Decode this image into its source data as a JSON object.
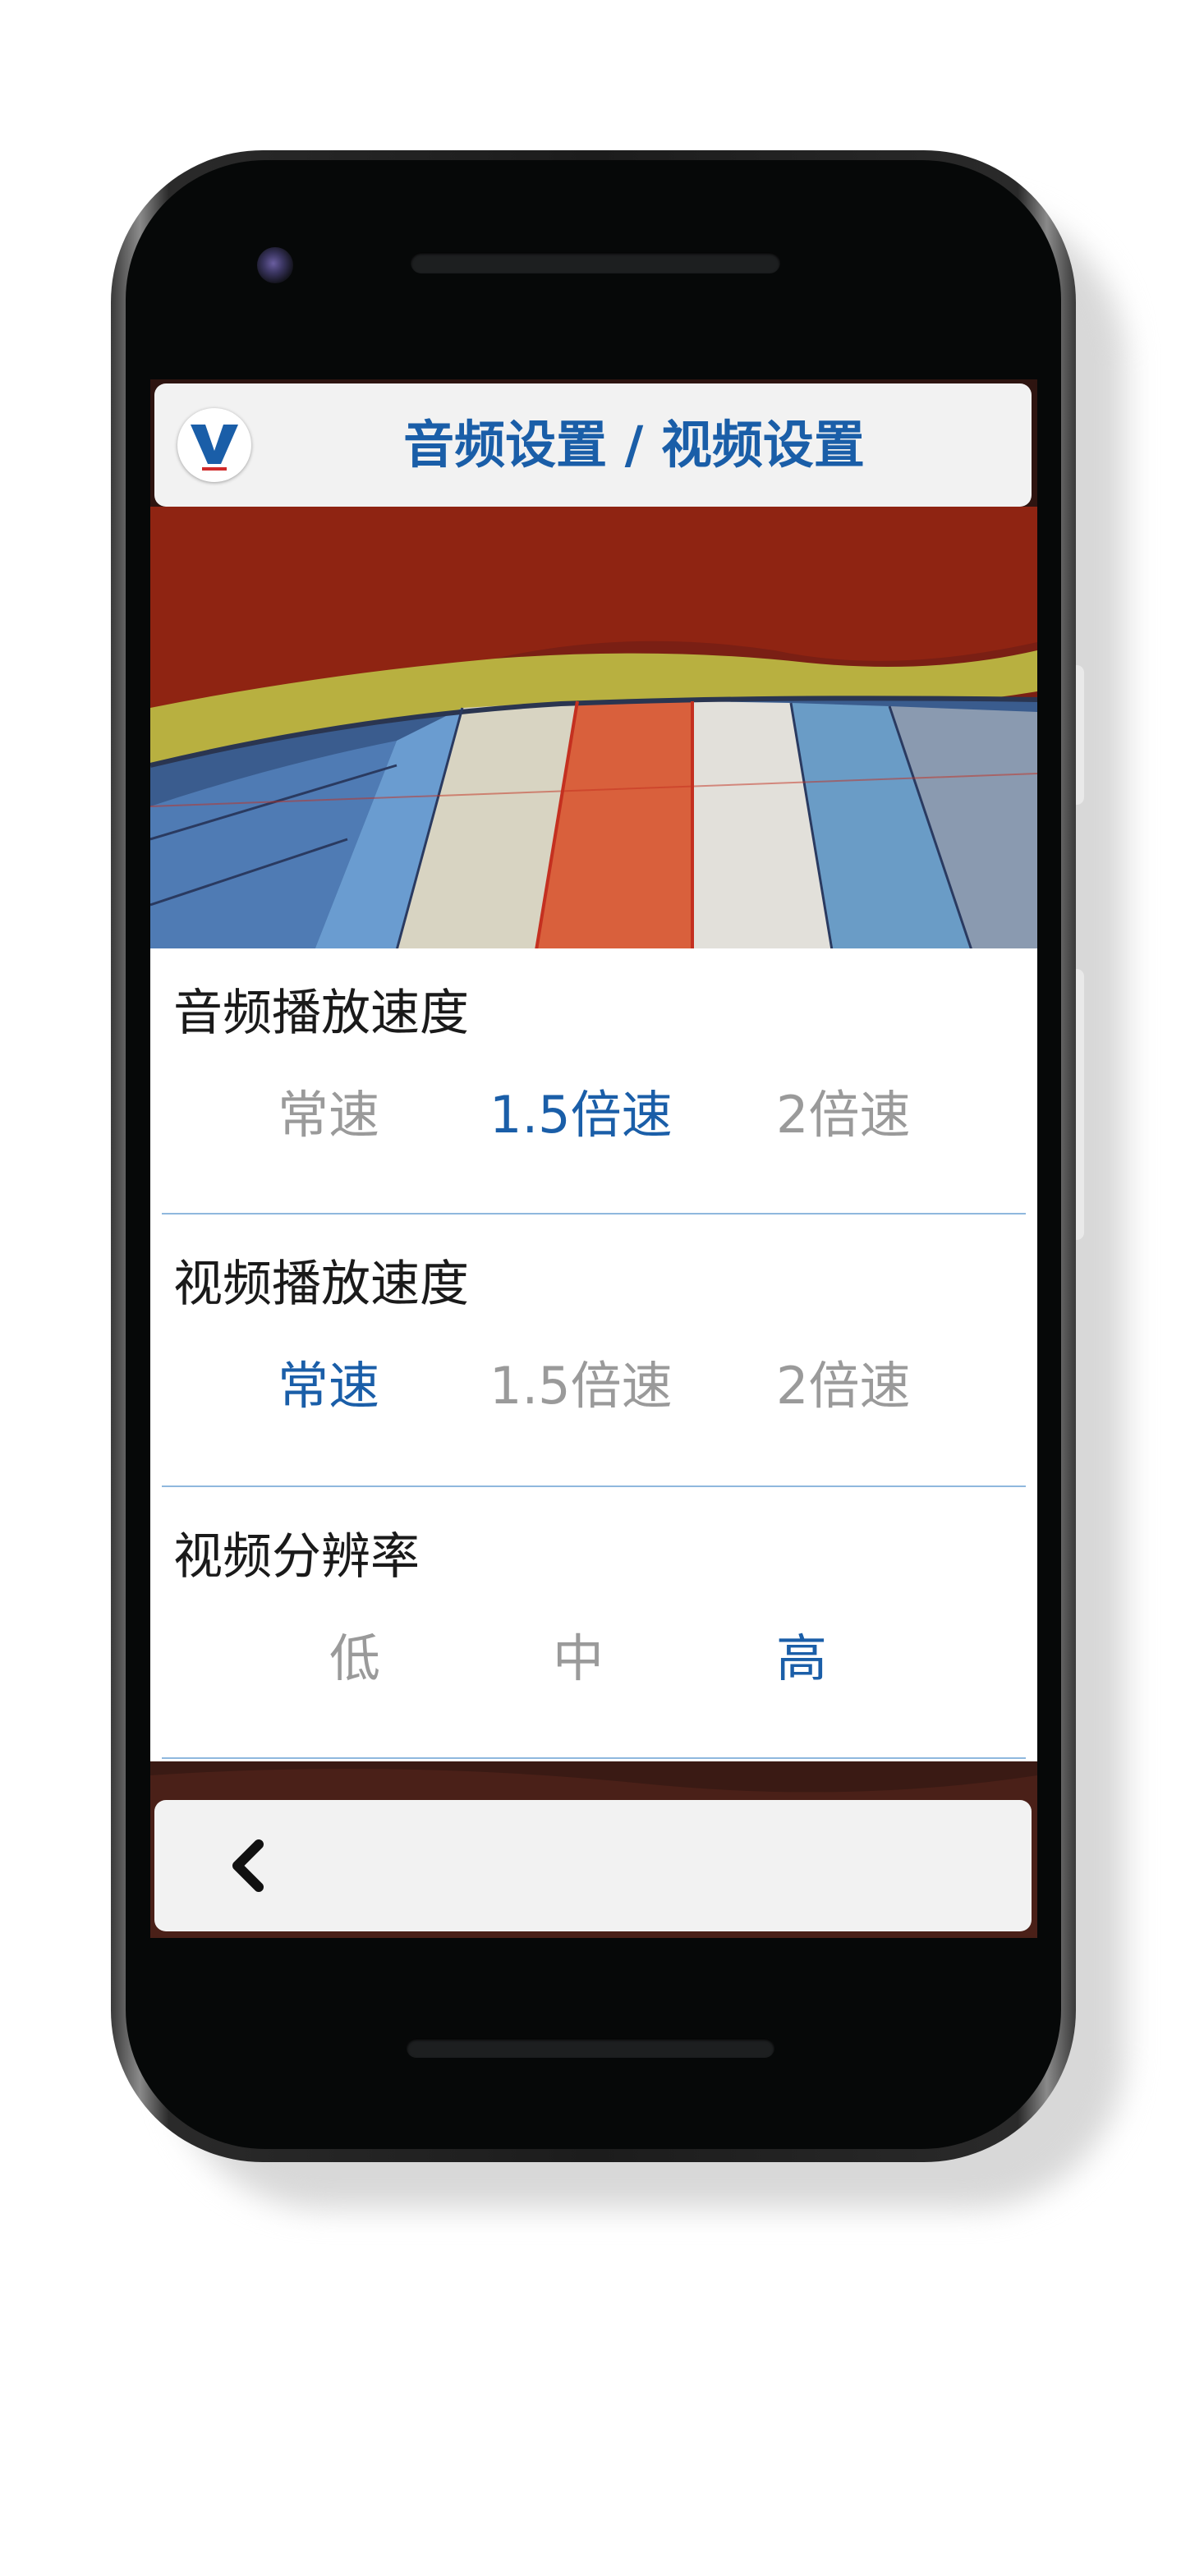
{
  "header": {
    "logo_icon": "v-logo-icon",
    "title": "音频设置 / 视频设置"
  },
  "sections": [
    {
      "title": "音频播放速度",
      "options": [
        {
          "label": "常速",
          "selected": false
        },
        {
          "label": "1.5倍速",
          "selected": true
        },
        {
          "label": "2倍速",
          "selected": false
        }
      ]
    },
    {
      "title": "视频播放速度",
      "options": [
        {
          "label": "常速",
          "selected": true
        },
        {
          "label": "1.5倍速",
          "selected": false
        },
        {
          "label": "2倍速",
          "selected": false
        }
      ]
    },
    {
      "title": "视频分辨率",
      "options": [
        {
          "label": "低",
          "selected": false
        },
        {
          "label": "中",
          "selected": false
        },
        {
          "label": "高",
          "selected": true
        }
      ]
    }
  ],
  "footer": {
    "back_icon": "chevron-left-icon"
  },
  "colors": {
    "accent": "#1a5ea8",
    "inactive": "#9a9a9a",
    "divider": "#8fb8de",
    "bar_bg": "#f2f2f2"
  }
}
